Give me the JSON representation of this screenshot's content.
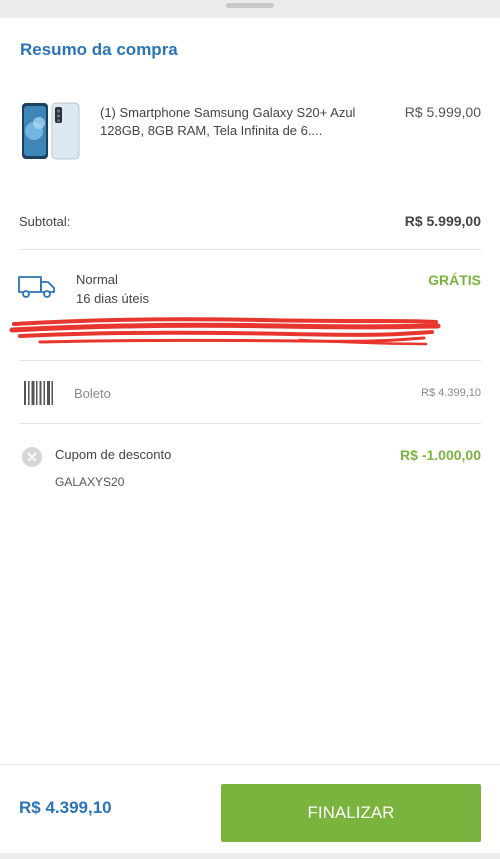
{
  "summary": {
    "title": "Resumo da compra"
  },
  "product": {
    "name": "(1) Smartphone Samsung Galaxy S20+ Azul 128GB, 8GB RAM, Tela Infinita de 6....",
    "price": "R$ 5.999,00",
    "image_icon": "phone-product-image"
  },
  "subtotal": {
    "label": "Subtotal:",
    "value": "R$ 5.999,00"
  },
  "shipping": {
    "name": "Normal",
    "days": "16 dias úteis",
    "price": "GRÁTIS",
    "icon": "truck-icon"
  },
  "payment": {
    "method": "Boleto",
    "amount": "R$ 4.399,10",
    "icon": "barcode-icon"
  },
  "coupon": {
    "label": "Cupom de desconto",
    "code": "GALAXYS20",
    "value": "R$ -1.000,00",
    "icon": "remove-icon"
  },
  "footer": {
    "total": "R$ 4.399,10",
    "button_label": "FINALIZAR"
  },
  "colors": {
    "accent_blue": "#2a74b7",
    "accent_green": "#7ab33d",
    "redaction_red": "#e8352d"
  }
}
